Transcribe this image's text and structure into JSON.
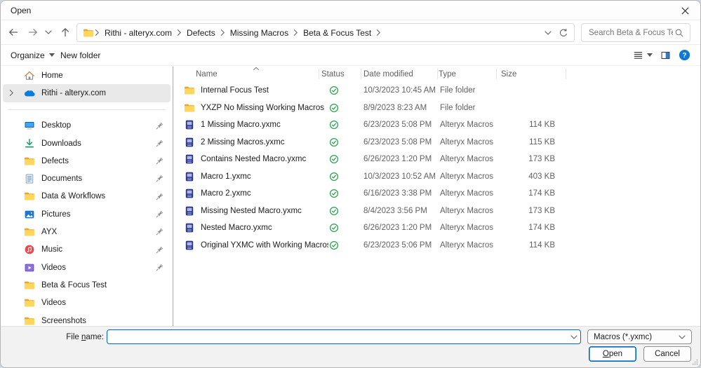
{
  "window": {
    "title": "Open"
  },
  "address": {
    "crumbs": [
      "Rithi - alteryx.com",
      "Defects",
      "Missing Macros",
      "Beta & Focus Test"
    ]
  },
  "search": {
    "placeholder": "Search Beta & Focus Test"
  },
  "toolbar": {
    "organize_label": "Organize",
    "new_folder_label": "New folder"
  },
  "sidebar": {
    "items": [
      {
        "label": "Home",
        "icon": "home"
      },
      {
        "label": "Rithi - alteryx.com",
        "icon": "onedrive",
        "selected": true,
        "expander": true
      },
      {
        "separator": true
      },
      {
        "label": "Desktop",
        "icon": "desktop",
        "pinned": true
      },
      {
        "label": "Downloads",
        "icon": "downloads",
        "pinned": true
      },
      {
        "label": "Defects",
        "icon": "folder",
        "pinned": true
      },
      {
        "label": "Documents",
        "icon": "documents",
        "pinned": true
      },
      {
        "label": "Data & Workflows",
        "icon": "folder",
        "pinned": true
      },
      {
        "label": "Pictures",
        "icon": "pictures",
        "pinned": true
      },
      {
        "label": "AYX",
        "icon": "folder",
        "pinned": true
      },
      {
        "label": "Music",
        "icon": "music",
        "pinned": true
      },
      {
        "label": "Videos",
        "icon": "videos",
        "pinned": true
      },
      {
        "label": "Beta & Focus Test",
        "icon": "folder"
      },
      {
        "label": "Videos",
        "icon": "folder"
      },
      {
        "label": "Screenshots",
        "icon": "folder"
      }
    ]
  },
  "list": {
    "columns": [
      "Name",
      "Status",
      "Date modified",
      "Type",
      "Size"
    ],
    "sort": {
      "column": "Name",
      "direction": "ascending"
    },
    "rows": [
      {
        "name": "Internal Focus Test",
        "icon": "folder",
        "status": "synced",
        "modified": "10/3/2023 10:45 AM",
        "type": "File folder",
        "size": ""
      },
      {
        "name": "YXZP No Missing Working Macros",
        "icon": "folder",
        "status": "synced",
        "modified": "8/9/2023 8:23 AM",
        "type": "File folder",
        "size": ""
      },
      {
        "name": "1 Missing Macro.yxmc",
        "icon": "macro",
        "status": "synced",
        "modified": "6/23/2023 5:08 PM",
        "type": "Alteryx Macros",
        "size": "114 KB"
      },
      {
        "name": "2 Missing Macros.yxmc",
        "icon": "macro",
        "status": "synced",
        "modified": "6/23/2023 5:08 PM",
        "type": "Alteryx Macros",
        "size": "115 KB"
      },
      {
        "name": "Contains Nested Macro.yxmc",
        "icon": "macro",
        "status": "synced",
        "modified": "6/26/2023 1:20 PM",
        "type": "Alteryx Macros",
        "size": "173 KB"
      },
      {
        "name": "Macro 1.yxmc",
        "icon": "macro",
        "status": "synced",
        "modified": "10/3/2023 10:52 AM",
        "type": "Alteryx Macros",
        "size": "403 KB"
      },
      {
        "name": "Macro 2.yxmc",
        "icon": "macro",
        "status": "synced",
        "modified": "6/16/2023 3:38 PM",
        "type": "Alteryx Macros",
        "size": "174 KB"
      },
      {
        "name": "Missing Nested Macro.yxmc",
        "icon": "macro",
        "status": "synced",
        "modified": "8/4/2023 3:56 PM",
        "type": "Alteryx Macros",
        "size": "173 KB"
      },
      {
        "name": "Nested Macro.yxmc",
        "icon": "macro",
        "status": "synced",
        "modified": "6/26/2023 1:20 PM",
        "type": "Alteryx Macros",
        "size": "174 KB"
      },
      {
        "name": "Original YXMC with Working Macros.yxmc",
        "icon": "macro",
        "status": "synced",
        "modified": "6/23/2023 5:06 PM",
        "type": "Alteryx Macros",
        "size": "114 KB"
      }
    ]
  },
  "footer": {
    "file_name_label": "File name:",
    "file_name_underline": "n",
    "file_name_value": "",
    "file_type_value": "Macros (*.yxmc)",
    "open_label": "Open",
    "open_underline": "O",
    "cancel_label": "Cancel"
  },
  "colors": {
    "accent": "#0067c0",
    "folder_front": "#ffd75e",
    "folder_back": "#eda62b",
    "sync_green": "#23a047",
    "onedrive_blue": "#0a7edd",
    "macro_blue": "#2b3990",
    "help_blue": "#0f78d7",
    "selection_bg": "#e9e9e9"
  }
}
